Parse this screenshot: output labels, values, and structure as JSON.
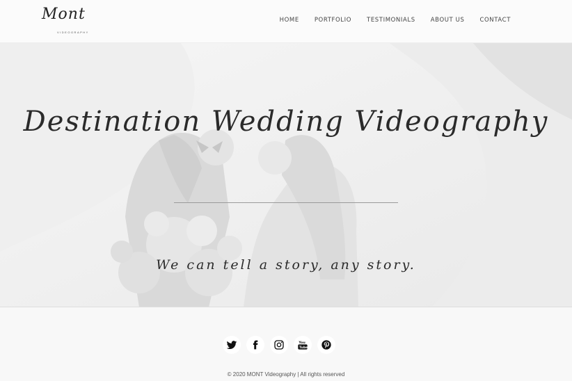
{
  "brand": {
    "logo_script": "Mont",
    "logo_sub": "VIDEOGRAPHY"
  },
  "nav": {
    "items": [
      "HOME",
      "PORTFOLIO",
      "TESTIMONIALS",
      "ABOUT US",
      "CONTACT"
    ]
  },
  "hero": {
    "title": "Destination Wedding Videography",
    "tagline": "We can tell a story, any story."
  },
  "footer": {
    "social_icons": [
      "twitter-icon",
      "facebook-icon",
      "instagram-icon",
      "youtube-icon",
      "pinterest-icon"
    ],
    "copyright": "© 2020 MONT Videography | All rights reserved"
  },
  "colors": {
    "hero_overlay": "#f2f2f2",
    "text_dark": "#2a2a2a",
    "footer_bg": "#f8f8f8"
  }
}
